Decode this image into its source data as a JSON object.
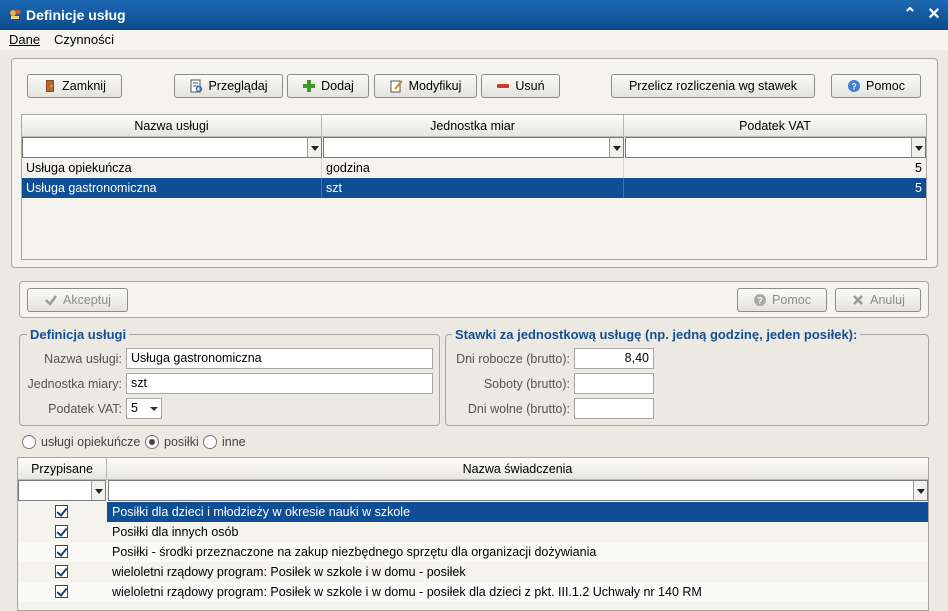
{
  "window": {
    "title": "Definicje usług"
  },
  "menu": [
    "Dane",
    "Czynności"
  ],
  "toolbar": {
    "close": "Zamknij",
    "browse": "Przeglądaj",
    "add": "Dodaj",
    "modify": "Modyfikuj",
    "delete": "Usuń",
    "recalc": "Przelicz rozliczenia wg stawek",
    "help": "Pomoc"
  },
  "services_table": {
    "columns": [
      "Nazwa usługi",
      "Jednostka miar",
      "Podatek VAT"
    ],
    "rows": [
      {
        "name": "Usługa opiekuńcza",
        "unit": "godzina",
        "vat": "5"
      },
      {
        "name": "Usługa gastronomiczna",
        "unit": "szt",
        "vat": "5"
      }
    ]
  },
  "edit_toolbar": {
    "accept": "Akceptuj",
    "help": "Pomoc",
    "cancel": "Anuluj"
  },
  "definition": {
    "title": "Definicja usługi",
    "name_label": "Nazwa usługi:",
    "name_value": "Usługa gastronomiczna",
    "unit_label": "Jednostka miary:",
    "unit_value": "szt",
    "vat_label": "Podatek VAT:",
    "vat_value": "5"
  },
  "rates": {
    "title": "Stawki za jednostkową usługę (np. jedną godzinę, jeden posiłek):",
    "workdays_label": "Dni robocze (brutto):",
    "workdays_value": "8,40",
    "saturdays_label": "Soboty (brutto):",
    "saturdays_value": "",
    "holidays_label": "Dni wolne (brutto):",
    "holidays_value": ""
  },
  "service_type": {
    "options": [
      "usługi opiekuńcze",
      "posiłki",
      "inne"
    ],
    "selected": "posiłki"
  },
  "benefits_table": {
    "columns": [
      "Przypisane",
      "Nazwa świadczenia"
    ],
    "rows": [
      {
        "assigned": true,
        "name": "Posiłki dla dzieci i młodzieży w okresie nauki w szkole"
      },
      {
        "assigned": true,
        "name": "Posiłki dla innych osób"
      },
      {
        "assigned": true,
        "name": "Posiłki - środki przeznaczone na zakup niezbędnego sprzętu dla organizacji dożywiania"
      },
      {
        "assigned": true,
        "name": "wieloletni rządowy program: Posiłek w szkole i w domu - posiłek"
      },
      {
        "assigned": true,
        "name": "wieloletni rządowy program: Posiłek w szkole i w domu - posiłek dla dzieci z pkt. III.1.2 Uchwały nr 140 RM"
      }
    ]
  },
  "colors": {
    "title_bar": "#0c4a8c",
    "selection": "#0f4e94",
    "group_title": "#164f91"
  }
}
